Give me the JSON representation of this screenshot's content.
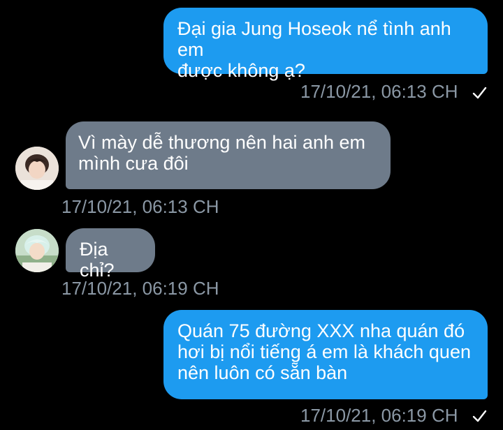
{
  "messages": [
    {
      "direction": "outgoing",
      "text": "Đại gia Jung Hoseok nể tình anh em\nđược không ạ?",
      "timestamp": "17/10/21, 06:13 CH",
      "status_icon": "check-icon"
    },
    {
      "direction": "incoming",
      "avatar": "profile-avatar-1",
      "text": "Vì mày dễ thương nên hai anh em\nmình cưa đôi",
      "timestamp": "17/10/21, 06:13 CH"
    },
    {
      "direction": "incoming",
      "avatar": "profile-avatar-2",
      "text": "Địa chỉ?",
      "timestamp": "17/10/21, 06:19 CH"
    },
    {
      "direction": "outgoing",
      "text": "Quán 75 đường XXX nha quán đó\nhơi bị nổi tiếng á em là khách quen\nnên luôn có sẵn bàn",
      "timestamp": "17/10/21, 06:19 CH",
      "status_icon": "check-icon"
    }
  ],
  "colors": {
    "background": "#000000",
    "outgoing_bubble": "#1d9bf0",
    "incoming_bubble": "#6e7b8a",
    "timestamp": "#8b98a5"
  }
}
